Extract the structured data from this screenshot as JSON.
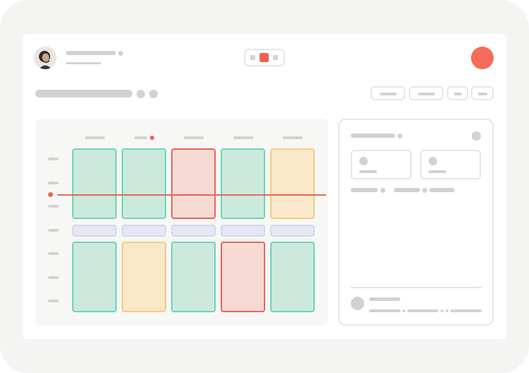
{
  "header": {
    "avatar": "user-avatar",
    "icons": {
      "view_toggle": "calendar-view-toggle-icon",
      "record": "record-button-icon"
    },
    "active_view_color": "#ee6255",
    "record_color": "#f56b5c"
  },
  "schedule": {
    "columns": 5,
    "rows": 2,
    "now_marker_color": "#e8655a",
    "colors": {
      "green": {
        "fill": "#cbeadd",
        "border": "#6fd4b4"
      },
      "red": {
        "fill": "#f7dad4",
        "border": "#e8655a"
      },
      "yellow": {
        "fill": "#f9e8c9",
        "border": "#f1cd7f"
      },
      "lavender": {
        "fill": "#e6e7f5",
        "border": "#d5d7ef"
      }
    },
    "top_row": [
      "green",
      "green",
      "red",
      "green",
      "yellow"
    ],
    "middle_row": [
      "lavender",
      "lavender",
      "lavender",
      "lavender",
      "lavender"
    ],
    "bottom_row": [
      "green",
      "yellow",
      "green",
      "red",
      "green"
    ]
  },
  "panel": {
    "icons": {
      "more": "panel-menu-icon",
      "footer_avatar": "footer-avatar"
    }
  }
}
